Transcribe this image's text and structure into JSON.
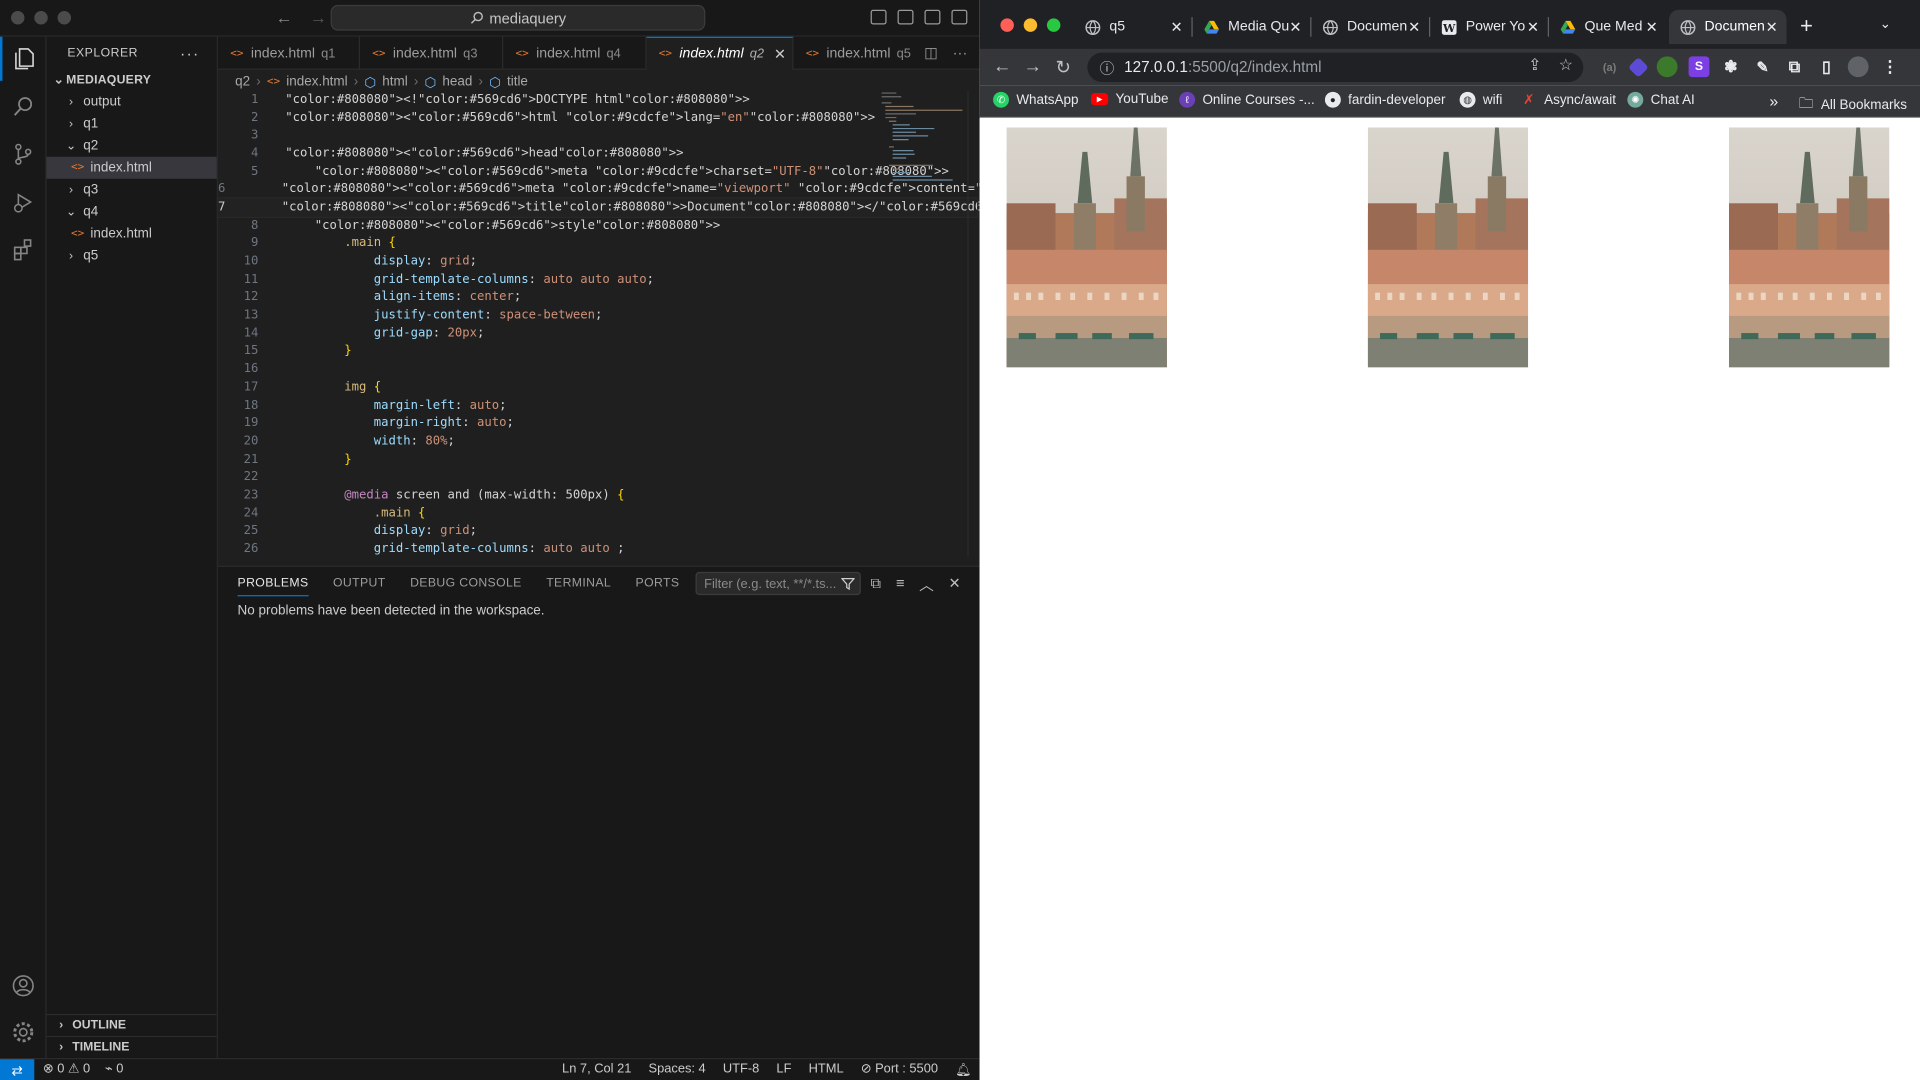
{
  "vscode": {
    "window_title": "mediaquery",
    "explorer": {
      "title": "EXPLORER",
      "root": "MEDIAQUERY",
      "items": [
        {
          "label": "output",
          "expanded": false
        },
        {
          "label": "q1",
          "expanded": false
        },
        {
          "label": "q2",
          "expanded": true
        },
        {
          "label": "index.html",
          "selected": true
        },
        {
          "label": "q3",
          "expanded": false
        },
        {
          "label": "q4",
          "expanded": true
        },
        {
          "label": "index.html"
        },
        {
          "label": "q5",
          "expanded": false
        }
      ],
      "outline": "OUTLINE",
      "timeline": "TIMELINE"
    },
    "tabs": [
      {
        "name": "index.html",
        "desc": "q1"
      },
      {
        "name": "index.html",
        "desc": "q3"
      },
      {
        "name": "index.html",
        "desc": "q4"
      },
      {
        "name": "index.html",
        "desc": "q2",
        "active": true
      },
      {
        "name": "index.html",
        "desc": "q5"
      }
    ],
    "breadcrumb": [
      "q2",
      "index.html",
      "html",
      "head",
      "title"
    ],
    "code_lines": [
      "<!DOCTYPE html>",
      "<html lang=\"en\">",
      "",
      "<head>",
      "    <meta charset=\"UTF-8\">",
      "    <meta name=\"viewport\" content=\"width=device-width, initial-scale=1.0\">",
      "    <title>Document</title>",
      "    <style>",
      "        .main {",
      "            display: grid;",
      "            grid-template-columns: auto auto auto;",
      "            align-items: center;",
      "            justify-content: space-between;",
      "            grid-gap: 20px;",
      "        }",
      "",
      "        img {",
      "            margin-left: auto;",
      "            margin-right: auto;",
      "            width: 80%;",
      "        }",
      "",
      "        @media screen and (max-width: 500px) {",
      "            .main {",
      "            display: grid;",
      "            grid-template-columns: auto auto ;"
    ],
    "current_line": 7,
    "panel": {
      "tabs": [
        "PROBLEMS",
        "OUTPUT",
        "DEBUG CONSOLE",
        "TERMINAL",
        "PORTS"
      ],
      "active_tab": "PROBLEMS",
      "filter_placeholder": "Filter (e.g. text, **/*.ts...",
      "message": "No problems have been detected in the workspace."
    },
    "status": {
      "errors": "0",
      "warnings": "0",
      "ports_forwarded": "0",
      "position": "Ln 7, Col 21",
      "spaces": "Spaces: 4",
      "encoding": "UTF-8",
      "eol": "LF",
      "language": "HTML",
      "port": "Port : 5500"
    }
  },
  "chrome": {
    "tabs": [
      {
        "title": "q5"
      },
      {
        "title": "Media Qu"
      },
      {
        "title": "Documen"
      },
      {
        "title": "Power Yo"
      },
      {
        "title": "Que Med"
      },
      {
        "title": "Documen",
        "active": true
      }
    ],
    "url_host": "127.0.0.1",
    "url_rest": ":5500/q2/index.html",
    "bookmarks": [
      "WhatsApp",
      "YouTube",
      "Online Courses -...",
      "fardin-developer",
      "wifi",
      "Async/await",
      "Chat AI"
    ],
    "all_bookmarks": "All Bookmarks",
    "page_images": 3,
    "colors": {
      "accent": "#0078d4",
      "tab_bar": "#202124",
      "toolbar": "#35363a"
    }
  }
}
